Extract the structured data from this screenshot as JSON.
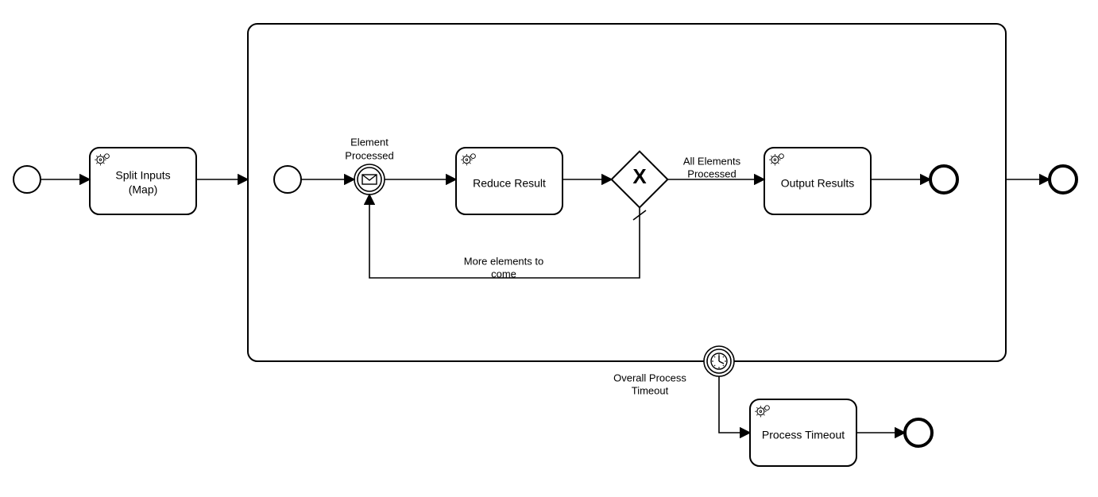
{
  "tasks": {
    "split_inputs": {
      "line1": "Split Inputs",
      "line2": "(Map)"
    },
    "reduce_result": "Reduce Result",
    "output_results": "Output Results",
    "process_timeout": "Process Timeout"
  },
  "events": {
    "element_processed": {
      "line1": "Element",
      "line2": "Processed"
    },
    "overall_timeout": {
      "line1": "Overall Process",
      "line2": "Timeout"
    }
  },
  "edges": {
    "all_processed": {
      "line1": "All Elements",
      "line2": "Processed"
    },
    "more_elements": {
      "line1": "More elements to",
      "line2": "come"
    }
  }
}
